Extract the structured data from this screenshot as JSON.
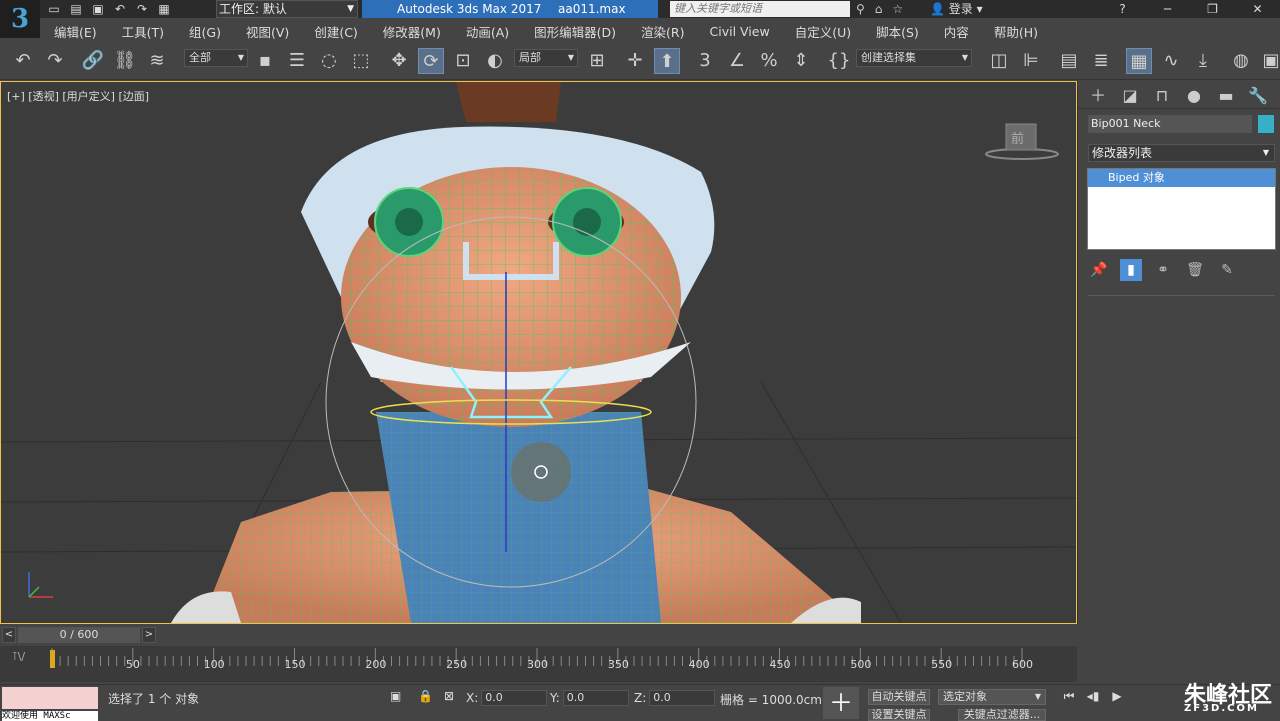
{
  "app": {
    "logo": "3",
    "workspace_label": "工作区: 默认",
    "product": "Autodesk 3ds Max 2017",
    "file": "aa011.max",
    "search_placeholder": "键入关键字或短语",
    "login": "登录"
  },
  "brand": {
    "name": "朱峰社区",
    "site": "ZF3D.COM"
  },
  "menu": [
    "编辑(E)",
    "工具(T)",
    "组(G)",
    "视图(V)",
    "创建(C)",
    "修改器(M)",
    "动画(A)",
    "图形编辑器(D)",
    "渲染(R)",
    "Civil View",
    "自定义(U)",
    "脚本(S)",
    "内容",
    "帮助(H)"
  ],
  "toolbar": {
    "filter": "全部",
    "coord_system": "局部",
    "selection_set": "创建选择集"
  },
  "viewport": {
    "label": "[+] [透视] [用户定义] [边面]",
    "viewcube": "前"
  },
  "command_panel": {
    "object_name": "Bip001 Neck",
    "object_color": "#35b0c8",
    "modifier_list": "修改器列表",
    "stack_item": "Biped 对象"
  },
  "timeline": {
    "frame": "0 / 600",
    "ticks": [
      "50",
      "100",
      "150",
      "200",
      "250",
      "300",
      "350",
      "400",
      "450",
      "500",
      "550",
      "600"
    ]
  },
  "status": {
    "maxscript": "欢迎使用 MAXSc",
    "selection": "选择了 1 个 对象",
    "x_label": "X:",
    "x": "0.0",
    "y_label": "Y:",
    "y": "0.0",
    "z_label": "Z:",
    "z": "0.0",
    "grid": "栅格 = 1000.0cm",
    "auto_key": "自动关键点",
    "selected_object": "选定对象",
    "set_key": "设置关键点",
    "key_filter": "关键点过滤器..."
  }
}
